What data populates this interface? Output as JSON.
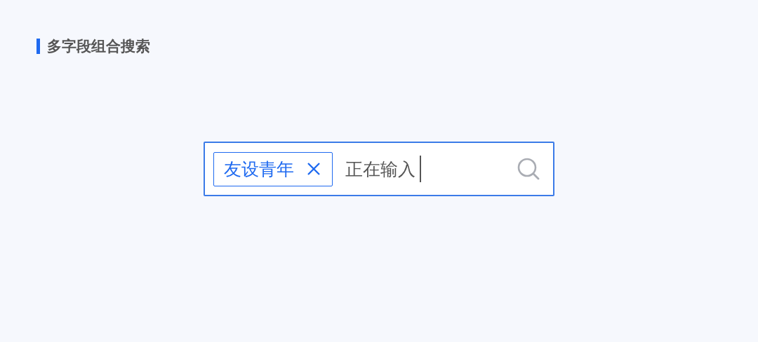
{
  "section_title": "多字段组合搜索",
  "search": {
    "focused": true,
    "tags": [
      {
        "label": "友设青年"
      }
    ],
    "value": "正在输入"
  }
}
